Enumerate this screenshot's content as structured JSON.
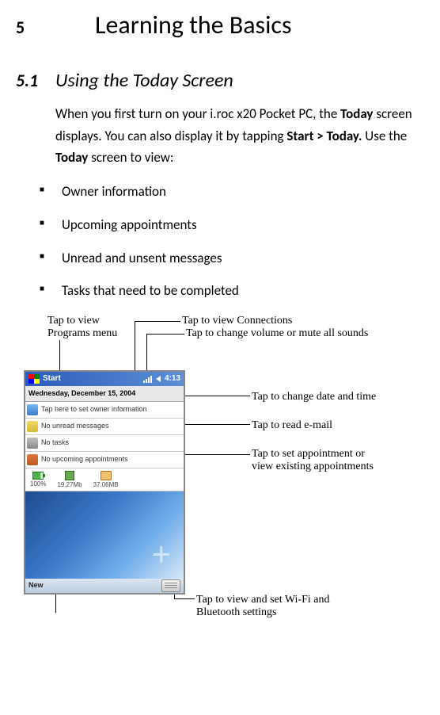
{
  "chapter": {
    "number": "5",
    "title": "Learning the Basics"
  },
  "section": {
    "number": "5.1",
    "title": "Using the Today Screen"
  },
  "paragraph": {
    "p1a": "When you first turn on your i.roc x20 Pocket PC, the ",
    "p1_today": "Today",
    "p1b": " screen displays. You can also display it by tapping ",
    "p1_start": "Start > Today.",
    "p1c": " Use the ",
    "p1_today2": "Today",
    "p1d": " screen to view:"
  },
  "bullets": [
    "Owner information",
    "Upcoming appointments",
    "Unread and unsent messages",
    "Tasks that need to be completed"
  ],
  "callouts": {
    "programs": "Tap to view\nPrograms menu",
    "connections": "Tap to view Connections",
    "volume": "Tap to change volume or mute all sounds",
    "datetime": "Tap to change date and time",
    "email": "Tap to read e-mail",
    "appt_a": "Tap to set appointment or",
    "appt_b": "view existing appointments",
    "wifi_a": "Tap to view and set Wi-Fi and",
    "wifi_b": "Bluetooth settings"
  },
  "screenshot": {
    "start": "Start",
    "time": "4:13",
    "date": "Wednesday, December 15, 2004",
    "owner": "Tap here to set owner information",
    "messages": "No unread messages",
    "tasks": "No tasks",
    "appts": "No upcoming appointments",
    "battery_pct": "100%",
    "mem": "19.27Mb",
    "storage": "37.06MB",
    "new": "New"
  }
}
